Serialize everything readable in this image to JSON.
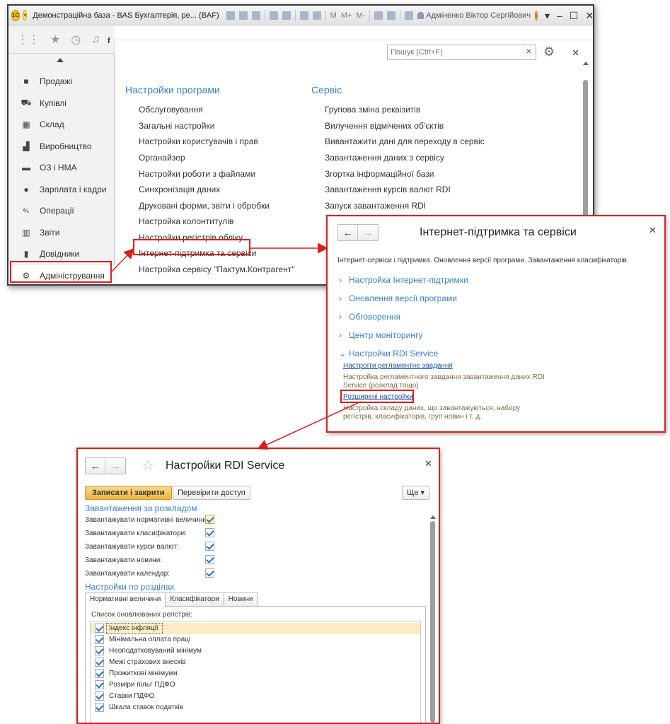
{
  "main_window": {
    "title": "Демонстраційна база - BAS Бухгалтерія, ре... (BAF)",
    "toolbar_memory": [
      "M",
      "M+",
      "M-"
    ],
    "user_name": "Адміненко Віктор Сергійович",
    "tab_stub": "f",
    "sidebar": {
      "items": [
        {
          "label": "Продажі",
          "icon": "shopping-bag-icon"
        },
        {
          "label": "Купівлі",
          "icon": "cart-icon"
        },
        {
          "label": "Склад",
          "icon": "warehouse-grid-icon"
        },
        {
          "label": "Виробництво",
          "icon": "factory-icon"
        },
        {
          "label": "ОЗ і НМА",
          "icon": "truck-icon"
        },
        {
          "label": "Зарплата і кадри",
          "icon": "person-icon"
        },
        {
          "label": "Операції",
          "icon": "dt-kt-icon"
        },
        {
          "label": "Звіти",
          "icon": "bar-chart-icon"
        },
        {
          "label": "Довідники",
          "icon": "books-icon"
        },
        {
          "label": "Адміністрування",
          "icon": "gear-icon"
        }
      ]
    }
  },
  "admin_panel": {
    "search_placeholder": "Пошук (Ctrl+F)",
    "section_settings": {
      "title": "Настройки програми",
      "items": [
        "Обслуговування",
        "Загальні настройки",
        "Настройки користувачів і прав",
        "Органайзер",
        "Настройки роботи з файлами",
        "Синхронізація даних",
        "Друковані форми, звіти і обробки",
        "Настройка колонтитулів",
        "Настройки регістрів обліку",
        "Інтернет-підтримка та сервіси",
        "Настройка сервісу \"Пактум.Контрагент\""
      ]
    },
    "section_service": {
      "title": "Сервіс",
      "items": [
        "Групова зміна реквізитів",
        "Вилучення відмічених об'єктів",
        "Вивантажити дані для переходу в сервіс",
        "Завантаження даних з сервісу",
        "Згортка інформаційної бази",
        "Завантаження курсів валют RDI",
        "Запуск завантаження RDI"
      ]
    }
  },
  "support_window": {
    "title": "Інтернет-підтримка та сервіси",
    "description": "Інтернет-сервіси і підтримка. Оновлення версії програми. Завантаження класифікаторів.",
    "groups": [
      "Настройка Інтернет-підтримки",
      "Оновлення версії програми",
      "Обговорення",
      "Центр моніторингу",
      "Настройки RDI Service"
    ],
    "links": [
      {
        "label": "Настроїти регламентне завдання",
        "desc": "Настройка регламентного завдання завантаження даних RDI Service (розклад тощо)"
      },
      {
        "label": "Розширені настройки",
        "desc": "Настройка складу даних, що завантажуються, набору регістрів, класифікаторів, груп новин і т. д."
      }
    ]
  },
  "rdi_window": {
    "title": "Настройки RDI Service",
    "save_close_label": "Записати і закрити",
    "check_access_label": "Перевірити доступ",
    "more_label": "Ще",
    "schedule_group": "Завантаження за розкладом",
    "schedule_fields": [
      {
        "label": "Завантажувати нормативні величини:",
        "checked": true
      },
      {
        "label": "Завантажувати класифікатори:",
        "checked": true
      },
      {
        "label": "Завантажувати курси валют:",
        "checked": true
      },
      {
        "label": "Завантажувати новини:",
        "checked": true
      },
      {
        "label": "Завантажувати календар:",
        "checked": true
      }
    ],
    "sections_group": "Настройки по розділах",
    "tabs": [
      "Нормативні величини",
      "Класифікатори",
      "Новини"
    ],
    "list_caption": "Список оновлюваних регістрів:",
    "registers": [
      {
        "label": "Індекс інфляції",
        "checked": true
      },
      {
        "label": "Мінімальна оплата праці",
        "checked": true
      },
      {
        "label": "Неоподатковуваний мінімум",
        "checked": true
      },
      {
        "label": "Межі страхових внесків",
        "checked": true
      },
      {
        "label": "Прожиткові мінімуми",
        "checked": true
      },
      {
        "label": "Розміри пільг ПДФО",
        "checked": true
      },
      {
        "label": "Ставки ПДФО",
        "checked": true
      },
      {
        "label": "Шкала ставок податків",
        "checked": true
      }
    ]
  },
  "colors": {
    "highlight": "#d62020",
    "link_blue": "#3b7fc4",
    "primary_button": "#f2b440"
  }
}
